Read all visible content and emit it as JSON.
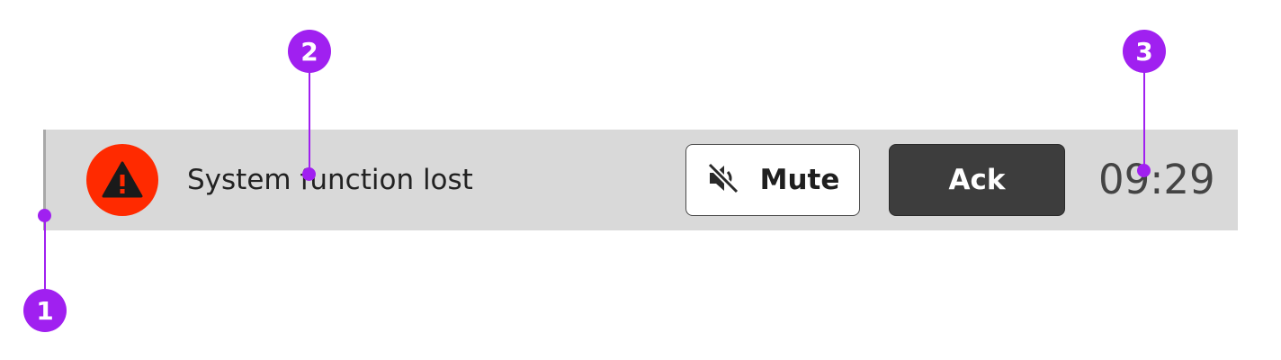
{
  "alert": {
    "icon": "warning-triangle-icon",
    "message": "System function lost",
    "time": "09:29"
  },
  "actions": {
    "mute": {
      "label": "Mute",
      "icon": "speaker-muted-icon"
    },
    "ack": {
      "label": "Ack"
    }
  },
  "callouts": [
    {
      "number": "1"
    },
    {
      "number": "2"
    },
    {
      "number": "3"
    }
  ],
  "colors": {
    "alarm_red": "#ff2a00",
    "bar_background": "#d9d9d9",
    "ack_background": "#3d3d3d",
    "callout_purple": "#a020f0"
  }
}
